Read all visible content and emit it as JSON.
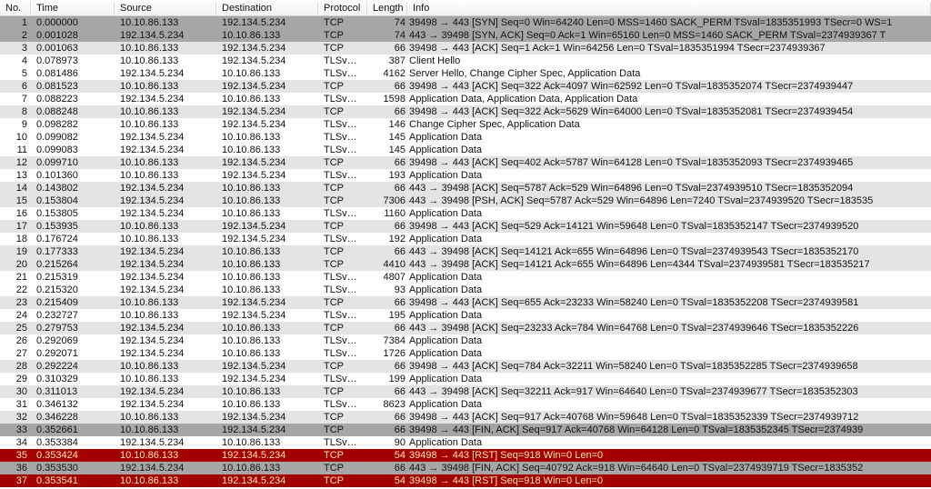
{
  "columns": {
    "no": "No.",
    "time": "Time",
    "source": "Source",
    "destination": "Destination",
    "protocol": "Protocol",
    "length": "Length",
    "info": "Info"
  },
  "ips": {
    "client": "10.10.86.133",
    "server": "192.134.5.234"
  },
  "rows": [
    {
      "no": 1,
      "time": "0.000000",
      "src": "10.10.86.133",
      "dst": "192.134.5.234",
      "proto": "TCP",
      "len": 74,
      "info": "39498 → 443 [SYN] Seq=0 Win=64240 Len=0 MSS=1460 SACK_PERM TSval=1835351993 TSecr=0 WS=1",
      "class": "gray"
    },
    {
      "no": 2,
      "time": "0.001028",
      "src": "192.134.5.234",
      "dst": "10.10.86.133",
      "proto": "TCP",
      "len": 74,
      "info": "443 → 39498 [SYN, ACK] Seq=0 Ack=1 Win=65160 Len=0 MSS=1460 SACK_PERM TSval=2374939367 T",
      "class": "gray"
    },
    {
      "no": 3,
      "time": "0.001063",
      "src": "10.10.86.133",
      "dst": "192.134.5.234",
      "proto": "TCP",
      "len": 66,
      "info": "39498 → 443 [ACK] Seq=1 Ack=1 Win=64256 Len=0 TSval=1835351994 TSecr=2374939367",
      "class": "lgray"
    },
    {
      "no": 4,
      "time": "0.078973",
      "src": "10.10.86.133",
      "dst": "192.134.5.234",
      "proto": "TLSv…",
      "len": 387,
      "info": "Client Hello",
      "class": "default"
    },
    {
      "no": 5,
      "time": "0.081486",
      "src": "192.134.5.234",
      "dst": "10.10.86.133",
      "proto": "TLSv…",
      "len": 4162,
      "info": "Server Hello, Change Cipher Spec, Application Data",
      "class": "default"
    },
    {
      "no": 6,
      "time": "0.081523",
      "src": "10.10.86.133",
      "dst": "192.134.5.234",
      "proto": "TCP",
      "len": 66,
      "info": "39498 → 443 [ACK] Seq=322 Ack=4097 Win=62592 Len=0 TSval=1835352074 TSecr=2374939447",
      "class": "lgray"
    },
    {
      "no": 7,
      "time": "0.088223",
      "src": "192.134.5.234",
      "dst": "10.10.86.133",
      "proto": "TLSv…",
      "len": 1598,
      "info": "Application Data, Application Data, Application Data",
      "class": "default"
    },
    {
      "no": 8,
      "time": "0.088248",
      "src": "10.10.86.133",
      "dst": "192.134.5.234",
      "proto": "TCP",
      "len": 66,
      "info": "39498 → 443 [ACK] Seq=322 Ack=5629 Win=64000 Len=0 TSval=1835352081 TSecr=2374939454",
      "class": "lgray"
    },
    {
      "no": 9,
      "time": "0.098282",
      "src": "10.10.86.133",
      "dst": "192.134.5.234",
      "proto": "TLSv…",
      "len": 146,
      "info": "Change Cipher Spec, Application Data",
      "class": "default"
    },
    {
      "no": 10,
      "time": "0.099082",
      "src": "192.134.5.234",
      "dst": "10.10.86.133",
      "proto": "TLSv…",
      "len": 145,
      "info": "Application Data",
      "class": "default"
    },
    {
      "no": 11,
      "time": "0.099083",
      "src": "192.134.5.234",
      "dst": "10.10.86.133",
      "proto": "TLSv…",
      "len": 145,
      "info": "Application Data",
      "class": "default"
    },
    {
      "no": 12,
      "time": "0.099710",
      "src": "10.10.86.133",
      "dst": "192.134.5.234",
      "proto": "TCP",
      "len": 66,
      "info": "39498 → 443 [ACK] Seq=402 Ack=5787 Win=64128 Len=0 TSval=1835352093 TSecr=2374939465",
      "class": "lgray"
    },
    {
      "no": 13,
      "time": "0.101360",
      "src": "10.10.86.133",
      "dst": "192.134.5.234",
      "proto": "TLSv…",
      "len": 193,
      "info": "Application Data",
      "class": "default"
    },
    {
      "no": 14,
      "time": "0.143802",
      "src": "192.134.5.234",
      "dst": "10.10.86.133",
      "proto": "TCP",
      "len": 66,
      "info": "443 → 39498 [ACK] Seq=5787 Ack=529 Win=64896 Len=0 TSval=2374939510 TSecr=1835352094",
      "class": "lgray"
    },
    {
      "no": 15,
      "time": "0.153804",
      "src": "192.134.5.234",
      "dst": "10.10.86.133",
      "proto": "TCP",
      "len": 7306,
      "info": "443 → 39498 [PSH, ACK] Seq=5787 Ack=529 Win=64896 Len=7240 TSval=2374939520 TSecr=183535",
      "class": "lgray"
    },
    {
      "no": 16,
      "time": "0.153805",
      "src": "192.134.5.234",
      "dst": "10.10.86.133",
      "proto": "TLSv…",
      "len": 1160,
      "info": "Application Data",
      "class": "default"
    },
    {
      "no": 17,
      "time": "0.153935",
      "src": "10.10.86.133",
      "dst": "192.134.5.234",
      "proto": "TCP",
      "len": 66,
      "info": "39498 → 443 [ACK] Seq=529 Ack=14121 Win=59648 Len=0 TSval=1835352147 TSecr=2374939520",
      "class": "lgray"
    },
    {
      "no": 18,
      "time": "0.176724",
      "src": "10.10.86.133",
      "dst": "192.134.5.234",
      "proto": "TLSv…",
      "len": 192,
      "info": "Application Data",
      "class": "default"
    },
    {
      "no": 19,
      "time": "0.177333",
      "src": "192.134.5.234",
      "dst": "10.10.86.133",
      "proto": "TCP",
      "len": 66,
      "info": "443 → 39498 [ACK] Seq=14121 Ack=655 Win=64896 Len=0 TSval=2374939543 TSecr=1835352170",
      "class": "lgray"
    },
    {
      "no": 20,
      "time": "0.215264",
      "src": "192.134.5.234",
      "dst": "10.10.86.133",
      "proto": "TCP",
      "len": 4410,
      "info": "443 → 39498 [ACK] Seq=14121 Ack=655 Win=64896 Len=4344 TSval=2374939581 TSecr=183535217",
      "class": "lgray"
    },
    {
      "no": 21,
      "time": "0.215319",
      "src": "192.134.5.234",
      "dst": "10.10.86.133",
      "proto": "TLSv…",
      "len": 4807,
      "info": "Application Data",
      "class": "default"
    },
    {
      "no": 22,
      "time": "0.215320",
      "src": "192.134.5.234",
      "dst": "10.10.86.133",
      "proto": "TLSv…",
      "len": 93,
      "info": "Application Data",
      "class": "default"
    },
    {
      "no": 23,
      "time": "0.215409",
      "src": "10.10.86.133",
      "dst": "192.134.5.234",
      "proto": "TCP",
      "len": 66,
      "info": "39498 → 443 [ACK] Seq=655 Ack=23233 Win=58240 Len=0 TSval=1835352208 TSecr=2374939581",
      "class": "lgray"
    },
    {
      "no": 24,
      "time": "0.232727",
      "src": "10.10.86.133",
      "dst": "192.134.5.234",
      "proto": "TLSv…",
      "len": 195,
      "info": "Application Data",
      "class": "default"
    },
    {
      "no": 25,
      "time": "0.279753",
      "src": "192.134.5.234",
      "dst": "10.10.86.133",
      "proto": "TCP",
      "len": 66,
      "info": "443 → 39498 [ACK] Seq=23233 Ack=784 Win=64768 Len=0 TSval=2374939646 TSecr=1835352226",
      "class": "lgray"
    },
    {
      "no": 26,
      "time": "0.292069",
      "src": "192.134.5.234",
      "dst": "10.10.86.133",
      "proto": "TLSv…",
      "len": 7384,
      "info": "Application Data",
      "class": "default"
    },
    {
      "no": 27,
      "time": "0.292071",
      "src": "192.134.5.234",
      "dst": "10.10.86.133",
      "proto": "TLSv…",
      "len": 1726,
      "info": "Application Data",
      "class": "default"
    },
    {
      "no": 28,
      "time": "0.292224",
      "src": "10.10.86.133",
      "dst": "192.134.5.234",
      "proto": "TCP",
      "len": 66,
      "info": "39498 → 443 [ACK] Seq=784 Ack=32211 Win=58240 Len=0 TSval=1835352285 TSecr=2374939658",
      "class": "lgray"
    },
    {
      "no": 29,
      "time": "0.310329",
      "src": "10.10.86.133",
      "dst": "192.134.5.234",
      "proto": "TLSv…",
      "len": 199,
      "info": "Application Data",
      "class": "default"
    },
    {
      "no": 30,
      "time": "0.311013",
      "src": "192.134.5.234",
      "dst": "10.10.86.133",
      "proto": "TCP",
      "len": 66,
      "info": "443 → 39498 [ACK] Seq=32211 Ack=917 Win=64640 Len=0 TSval=2374939677 TSecr=1835352303",
      "class": "lgray"
    },
    {
      "no": 31,
      "time": "0.346132",
      "src": "192.134.5.234",
      "dst": "10.10.86.133",
      "proto": "TLSv…",
      "len": 8623,
      "info": "Application Data",
      "class": "default"
    },
    {
      "no": 32,
      "time": "0.346228",
      "src": "10.10.86.133",
      "dst": "192.134.5.234",
      "proto": "TCP",
      "len": 66,
      "info": "39498 → 443 [ACK] Seq=917 Ack=40768 Win=59648 Len=0 TSval=1835352339 TSecr=2374939712",
      "class": "lgray"
    },
    {
      "no": 33,
      "time": "0.352661",
      "src": "10.10.86.133",
      "dst": "192.134.5.234",
      "proto": "TCP",
      "len": 66,
      "info": "39498 → 443 [FIN, ACK] Seq=917 Ack=40768 Win=64128 Len=0 TSval=1835352345 TSecr=2374939",
      "class": "gray"
    },
    {
      "no": 34,
      "time": "0.353384",
      "src": "192.134.5.234",
      "dst": "10.10.86.133",
      "proto": "TLSv…",
      "len": 90,
      "info": "Application Data",
      "class": "default"
    },
    {
      "no": 35,
      "time": "0.353424",
      "src": "10.10.86.133",
      "dst": "192.134.5.234",
      "proto": "TCP",
      "len": 54,
      "info": "39498 → 443 [RST] Seq=918 Win=0 Len=0",
      "class": "red"
    },
    {
      "no": 36,
      "time": "0.353530",
      "src": "192.134.5.234",
      "dst": "10.10.86.133",
      "proto": "TCP",
      "len": 66,
      "info": "443 → 39498 [FIN, ACK] Seq=40792 Ack=918 Win=64640 Len=0 TSval=2374939719 TSecr=1835352",
      "class": "gray"
    },
    {
      "no": 37,
      "time": "0.353541",
      "src": "10.10.86.133",
      "dst": "192.134.5.234",
      "proto": "TCP",
      "len": 54,
      "info": "39498 → 443 [RST] Seq=918 Win=0 Len=0",
      "class": "red"
    }
  ]
}
